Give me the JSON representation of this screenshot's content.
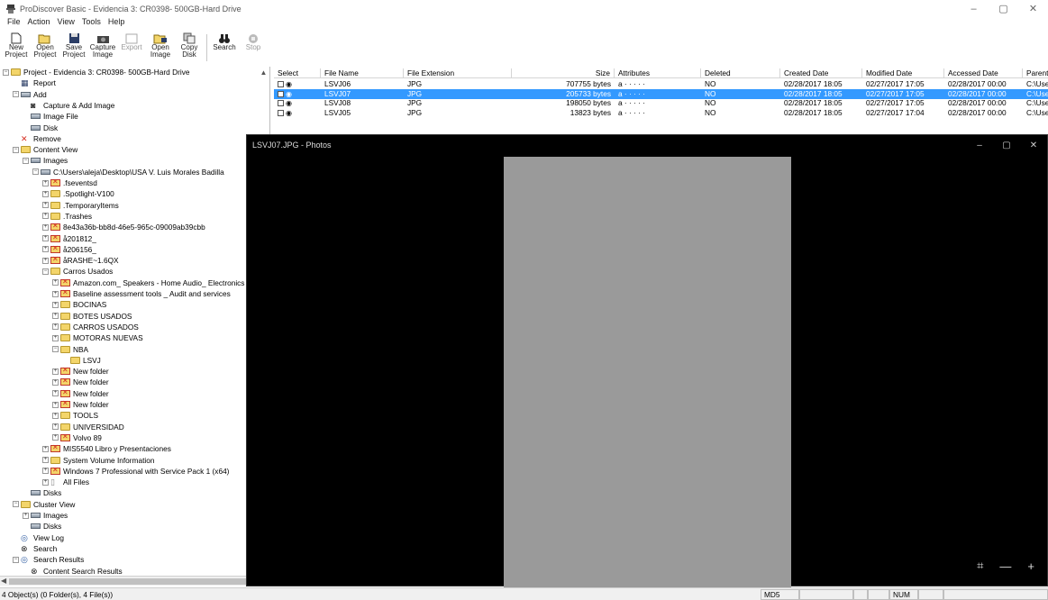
{
  "window": {
    "title": "ProDiscover Basic - Evidencia 3: CR0398- 500GB-Hard Drive",
    "controls": [
      "–",
      "▢",
      "✕"
    ]
  },
  "menu": [
    "File",
    "Action",
    "View",
    "Tools",
    "Help"
  ],
  "toolbar": {
    "buttons": [
      {
        "label": "New Project",
        "icon": "new-document-icon",
        "enabled": true
      },
      {
        "label": "Open Project",
        "icon": "open-folder-icon",
        "enabled": true
      },
      {
        "label": "Save Project",
        "icon": "floppy-disk-icon",
        "enabled": true
      },
      {
        "label": "Capture Image",
        "icon": "camera-icon",
        "enabled": true
      },
      {
        "label": "Export",
        "icon": "export-icon",
        "enabled": false
      },
      {
        "label": "Open Image",
        "icon": "open-image-icon",
        "enabled": true
      },
      {
        "label": "Copy Disk",
        "icon": "copy-disk-icon",
        "enabled": true
      },
      {
        "label": "Search",
        "icon": "binoculars-icon",
        "enabled": true
      },
      {
        "label": "Stop",
        "icon": "stop-icon",
        "enabled": false
      }
    ]
  },
  "tree": [
    {
      "text": "Project - Evidencia 3: CR0398- 500GB-Hard Drive",
      "level": 0,
      "icon": "folder",
      "exp": "-"
    },
    {
      "text": "Report",
      "level": 1,
      "icon": "report",
      "exp": ""
    },
    {
      "text": "Add",
      "level": 1,
      "icon": "hdd",
      "exp": "-"
    },
    {
      "text": "Capture & Add Image",
      "level": 2,
      "icon": "camera",
      "exp": ""
    },
    {
      "text": "Image File",
      "level": 2,
      "icon": "hdd",
      "exp": ""
    },
    {
      "text": "Disk",
      "level": 2,
      "icon": "hdd",
      "exp": ""
    },
    {
      "text": "Remove",
      "level": 1,
      "icon": "remove",
      "exp": ""
    },
    {
      "text": "Content View",
      "level": 1,
      "icon": "folder",
      "exp": "-"
    },
    {
      "text": "Images",
      "level": 2,
      "icon": "hdd",
      "exp": "-"
    },
    {
      "text": "C:\\Users\\aleja\\Desktop\\USA V. Luis Morales Badilla",
      "level": 3,
      "icon": "hdd",
      "exp": "-"
    },
    {
      "text": ".fseventsd",
      "level": 4,
      "icon": "xfolder",
      "exp": "+"
    },
    {
      "text": ".Spotlight-V100",
      "level": 4,
      "icon": "folder",
      "exp": "+"
    },
    {
      "text": ".TemporaryItems",
      "level": 4,
      "icon": "folder",
      "exp": "+"
    },
    {
      "text": ".Trashes",
      "level": 4,
      "icon": "folder",
      "exp": "+"
    },
    {
      "text": "8e43a36b-bb8d-46e5-965c-09009ab39cbb",
      "level": 4,
      "icon": "xfolder",
      "exp": "+"
    },
    {
      "text": "å201812_",
      "level": 4,
      "icon": "xfolder",
      "exp": "+"
    },
    {
      "text": "å206156_",
      "level": 4,
      "icon": "xfolder",
      "exp": "+"
    },
    {
      "text": "åRASHE~1.6QX",
      "level": 4,
      "icon": "xfolder",
      "exp": "+"
    },
    {
      "text": "Carros Usados",
      "level": 4,
      "icon": "folder",
      "exp": "-"
    },
    {
      "text": "Amazon.com_ Speakers - Home Audio_ Electronics",
      "level": 5,
      "icon": "xfolder",
      "exp": "+"
    },
    {
      "text": "Baseline assessment tools _ Audit and services",
      "level": 5,
      "icon": "xfolder",
      "exp": "+"
    },
    {
      "text": "BOCINAS",
      "level": 5,
      "icon": "folder",
      "exp": "+"
    },
    {
      "text": "BOTES USADOS",
      "level": 5,
      "icon": "folder",
      "exp": "+"
    },
    {
      "text": "CARROS USADOS",
      "level": 5,
      "icon": "folder",
      "exp": "+"
    },
    {
      "text": "MOTORAS NUEVAS",
      "level": 5,
      "icon": "folder",
      "exp": "+"
    },
    {
      "text": "NBA",
      "level": 5,
      "icon": "folder",
      "exp": "-"
    },
    {
      "text": "LSVJ",
      "level": 6,
      "icon": "folder",
      "exp": ""
    },
    {
      "text": "New folder",
      "level": 5,
      "icon": "xfolder",
      "exp": "+"
    },
    {
      "text": "New folder",
      "level": 5,
      "icon": "xfolder",
      "exp": "+"
    },
    {
      "text": "New folder",
      "level": 5,
      "icon": "xfolder",
      "exp": "+"
    },
    {
      "text": "New folder",
      "level": 5,
      "icon": "xfolder",
      "exp": "+"
    },
    {
      "text": "TOOLS",
      "level": 5,
      "icon": "folder",
      "exp": "+"
    },
    {
      "text": "UNIVERSIDAD",
      "level": 5,
      "icon": "folder",
      "exp": "+"
    },
    {
      "text": "Volvo 89",
      "level": 5,
      "icon": "xfolder",
      "exp": "+"
    },
    {
      "text": "MIS5540 Libro y Presentaciones",
      "level": 4,
      "icon": "xfolder",
      "exp": "+"
    },
    {
      "text": "System Volume Information",
      "level": 4,
      "icon": "folder",
      "exp": "+"
    },
    {
      "text": "Windows 7 Professional with Service Pack 1 (x64)",
      "level": 4,
      "icon": "xfolder",
      "exp": "+"
    },
    {
      "text": "All Files",
      "level": 4,
      "icon": "file",
      "exp": "+"
    },
    {
      "text": "Disks",
      "level": 2,
      "icon": "hdd",
      "exp": ""
    },
    {
      "text": "Cluster View",
      "level": 1,
      "icon": "folder",
      "exp": "-"
    },
    {
      "text": "Images",
      "level": 2,
      "icon": "hdd",
      "exp": "+"
    },
    {
      "text": "Disks",
      "level": 2,
      "icon": "hdd",
      "exp": ""
    },
    {
      "text": "View Log",
      "level": 1,
      "icon": "eye",
      "exp": ""
    },
    {
      "text": "Search",
      "level": 1,
      "icon": "binoculars",
      "exp": ""
    },
    {
      "text": "Search Results",
      "level": 1,
      "icon": "eye",
      "exp": "-"
    },
    {
      "text": "Content Search Results",
      "level": 2,
      "icon": "binoculars",
      "exp": ""
    }
  ],
  "table": {
    "headers": [
      "Select",
      "File Name",
      "File Extension",
      "Size",
      "Attributes",
      "Deleted",
      "Created Date",
      "Modified Date",
      "Accessed Date",
      "Parent Folder"
    ],
    "rows": [
      [
        "",
        "LSVJ06",
        "JPG",
        "707755 bytes",
        "a · · · · ·",
        "NO",
        "02/28/2017 18:05",
        "02/27/2017 17:05",
        "02/28/2017 00:00",
        "C:\\Users\\aleja\\Des"
      ],
      [
        "",
        "LSVJ07",
        "JPG",
        "205733 bytes",
        "a · · · · ·",
        "NO",
        "02/28/2017 18:05",
        "02/27/2017 17:05",
        "02/28/2017 00:00",
        "C:\\Users\\aleja\\Des"
      ],
      [
        "",
        "LSVJ08",
        "JPG",
        "198050 bytes",
        "a · · · · ·",
        "NO",
        "02/28/2017 18:05",
        "02/27/2017 17:05",
        "02/28/2017 00:00",
        "C:\\Users\\aleja\\Des"
      ],
      [
        "",
        "LSVJ05",
        "JPG",
        "13823 bytes",
        "a · · · · ·",
        "NO",
        "02/28/2017 18:05",
        "02/27/2017 17:04",
        "02/28/2017 00:00",
        "C:\\Users\\aleja\\Des"
      ]
    ],
    "selected_row": 1
  },
  "photos": {
    "title": "LSVJ07.JPG - Photos",
    "controls": [
      "–",
      "▢",
      "✕"
    ],
    "bottom_controls": [
      "⌗",
      "—",
      "+"
    ]
  },
  "status": {
    "text": "4 Object(s) (0 Folder(s), 4 File(s))",
    "cells": [
      "MD5",
      "",
      "",
      "",
      "NUM",
      "",
      ""
    ]
  }
}
